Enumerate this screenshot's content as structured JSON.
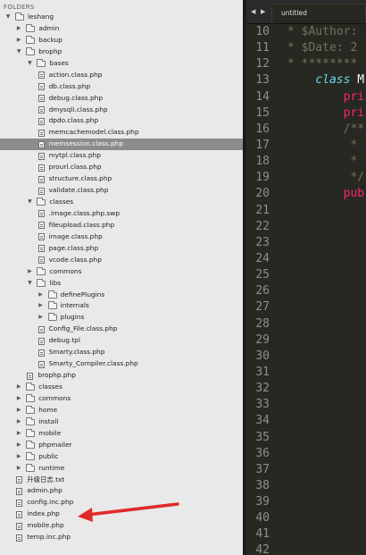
{
  "sidebar": {
    "header": "FOLDERS",
    "rows": [
      {
        "label": "leshang",
        "type": "folder",
        "open": true,
        "indent": 0
      },
      {
        "label": "admin",
        "type": "folder",
        "open": false,
        "indent": 1
      },
      {
        "label": "backup",
        "type": "folder",
        "open": false,
        "indent": 1
      },
      {
        "label": "brophp",
        "type": "folder",
        "open": true,
        "indent": 1
      },
      {
        "label": "bases",
        "type": "folder",
        "open": true,
        "indent": 2
      },
      {
        "label": "action.class.php",
        "type": "file",
        "indent": 3
      },
      {
        "label": "db.class.php",
        "type": "file",
        "indent": 3
      },
      {
        "label": "debug.class.php",
        "type": "file",
        "indent": 3
      },
      {
        "label": "dmysqli.class.php",
        "type": "file",
        "indent": 3
      },
      {
        "label": "dpdo.class.php",
        "type": "file",
        "indent": 3
      },
      {
        "label": "memcachemodel.class.php",
        "type": "file",
        "indent": 3
      },
      {
        "label": "memsession.class.php",
        "type": "file",
        "indent": 3,
        "selected": true
      },
      {
        "label": "mytpl.class.php",
        "type": "file",
        "indent": 3
      },
      {
        "label": "prourl.class.php",
        "type": "file",
        "indent": 3
      },
      {
        "label": "structure.class.php",
        "type": "file",
        "indent": 3
      },
      {
        "label": "validate.class.php",
        "type": "file",
        "indent": 3
      },
      {
        "label": "classes",
        "type": "folder",
        "open": true,
        "indent": 2
      },
      {
        "label": ".image.class.php.swp",
        "type": "file",
        "indent": 3
      },
      {
        "label": "fileupload.class.php",
        "type": "file",
        "indent": 3
      },
      {
        "label": "image.class.php",
        "type": "file",
        "indent": 3
      },
      {
        "label": "page.class.php",
        "type": "file",
        "indent": 3
      },
      {
        "label": "vcode.class.php",
        "type": "file",
        "indent": 3
      },
      {
        "label": "commons",
        "type": "folder",
        "open": false,
        "indent": 2
      },
      {
        "label": "libs",
        "type": "folder",
        "open": true,
        "indent": 2
      },
      {
        "label": "definePlugins",
        "type": "folder",
        "open": false,
        "indent": 3
      },
      {
        "label": "internals",
        "type": "folder",
        "open": false,
        "indent": 3
      },
      {
        "label": "plugins",
        "type": "folder",
        "open": false,
        "indent": 3
      },
      {
        "label": "Config_File.class.php",
        "type": "file",
        "indent": 3
      },
      {
        "label": "debug.tpl",
        "type": "file",
        "indent": 3
      },
      {
        "label": "Smarty.class.php",
        "type": "file",
        "indent": 3
      },
      {
        "label": "Smarty_Compiler.class.php",
        "type": "file",
        "indent": 3
      },
      {
        "label": "brophp.php",
        "type": "file",
        "indent": 2
      },
      {
        "label": "classes",
        "type": "folder",
        "open": false,
        "indent": 1
      },
      {
        "label": "commons",
        "type": "folder",
        "open": false,
        "indent": 1
      },
      {
        "label": "home",
        "type": "folder",
        "open": false,
        "indent": 1
      },
      {
        "label": "install",
        "type": "folder",
        "open": false,
        "indent": 1
      },
      {
        "label": "mobile",
        "type": "folder",
        "open": false,
        "indent": 1
      },
      {
        "label": "phpmailer",
        "type": "folder",
        "open": false,
        "indent": 1
      },
      {
        "label": "public",
        "type": "folder",
        "open": false,
        "indent": 1
      },
      {
        "label": "runtime",
        "type": "folder",
        "open": false,
        "indent": 1
      },
      {
        "label": "升级日志.txt",
        "type": "file",
        "indent": 1
      },
      {
        "label": "admin.php",
        "type": "file",
        "indent": 1
      },
      {
        "label": "config.inc.php",
        "type": "file",
        "indent": 1
      },
      {
        "label": "index.php",
        "type": "file",
        "indent": 1
      },
      {
        "label": "mobile.php",
        "type": "file",
        "indent": 1
      },
      {
        "label": "temp.inc.php",
        "type": "file",
        "indent": 1
      }
    ]
  },
  "editor": {
    "nav_back": "◀",
    "nav_forward": "▶",
    "tab_label": "untitled",
    "lines": [
      {
        "n": "10",
        "parts": [
          {
            "t": "* $Author:",
            "c": "cm"
          }
        ]
      },
      {
        "n": "11",
        "parts": [
          {
            "t": "* $Date: 2",
            "c": "cm"
          }
        ]
      },
      {
        "n": "12",
        "parts": [
          {
            "t": "* ********",
            "c": "cm"
          }
        ]
      },
      {
        "n": "13",
        "parts": [
          {
            "t": "    ",
            "c": "cl"
          },
          {
            "t": "class",
            "c": "kw"
          },
          {
            "t": " M",
            "c": "cl"
          }
        ]
      },
      {
        "n": "14",
        "parts": [
          {
            "t": "        pri",
            "c": "pk"
          }
        ]
      },
      {
        "n": "15",
        "parts": [
          {
            "t": "        pri",
            "c": "pk"
          }
        ]
      },
      {
        "n": "16",
        "parts": [
          {
            "t": "        /**",
            "c": "cm"
          }
        ]
      },
      {
        "n": "17",
        "parts": [
          {
            "t": "         *",
            "c": "cm"
          }
        ]
      },
      {
        "n": "18",
        "parts": [
          {
            "t": "         *",
            "c": "cm"
          }
        ]
      },
      {
        "n": "19",
        "parts": [
          {
            "t": "         */",
            "c": "cm"
          }
        ]
      },
      {
        "n": "20",
        "parts": [
          {
            "t": "        pub",
            "c": "pk"
          }
        ]
      },
      {
        "n": "21",
        "parts": []
      },
      {
        "n": "22",
        "parts": []
      },
      {
        "n": "23",
        "parts": []
      },
      {
        "n": "24",
        "parts": []
      },
      {
        "n": "25",
        "parts": []
      },
      {
        "n": "26",
        "parts": []
      },
      {
        "n": "27",
        "parts": []
      },
      {
        "n": "28",
        "parts": []
      },
      {
        "n": "29",
        "parts": []
      },
      {
        "n": "30",
        "parts": []
      },
      {
        "n": "31",
        "parts": []
      },
      {
        "n": "32",
        "parts": []
      },
      {
        "n": "33",
        "parts": []
      },
      {
        "n": "34",
        "parts": []
      },
      {
        "n": "35",
        "parts": []
      },
      {
        "n": "36",
        "parts": []
      },
      {
        "n": "37",
        "parts": []
      },
      {
        "n": "38",
        "parts": []
      },
      {
        "n": "39",
        "parts": []
      },
      {
        "n": "40",
        "parts": []
      },
      {
        "n": "41",
        "parts": []
      },
      {
        "n": "42",
        "parts": []
      }
    ]
  },
  "colors": {
    "annotation_arrow": "#e02a2a",
    "selection": "#8c8c8c",
    "editor_bg": "#272822"
  }
}
